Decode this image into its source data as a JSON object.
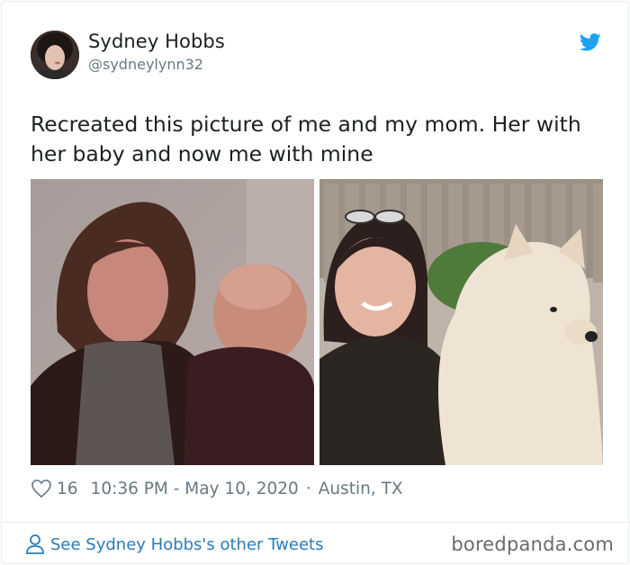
{
  "author": {
    "display_name": "Sydney Hobbs",
    "handle": "@sydneylynn32"
  },
  "tweet": {
    "text": "Recreated this picture of me and my mom. Her with her baby and now me with mine"
  },
  "media": [
    {
      "name": "old-photo-mom-and-baby"
    },
    {
      "name": "new-photo-daughter-and-dog"
    }
  ],
  "meta": {
    "likes": "16",
    "timestamp": "10:36 PM - May 10, 2020",
    "separator": "·",
    "location": "Austin, TX"
  },
  "footer": {
    "see_more_label": "See Sydney Hobbs's other Tweets",
    "watermark": "boredpanda.com"
  },
  "icons": {
    "brand": "twitter-bird-icon",
    "like": "heart-icon",
    "profile": "person-icon"
  },
  "colors": {
    "twitter_blue": "#1da1f2",
    "link_blue": "#2b7bb9",
    "muted_gray": "#697882",
    "text": "#1c2022"
  }
}
